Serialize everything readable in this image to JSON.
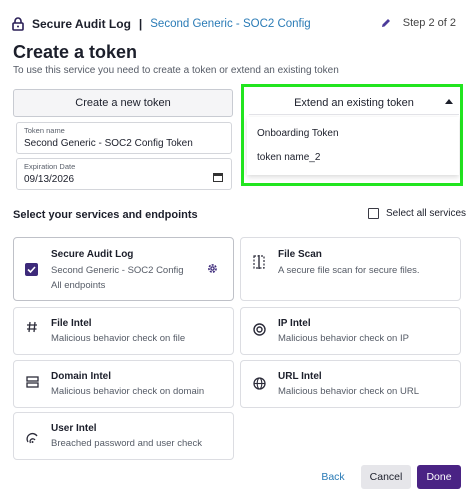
{
  "header": {
    "app_name": "Secure Audit Log",
    "separator": "|",
    "config_name": "Second Generic - SOC2 Config",
    "step": "Step 2 of 2"
  },
  "page": {
    "title": "Create a token",
    "subtitle": "To use this service you need to create a token or extend an existing token"
  },
  "token_form": {
    "create_label": "Create a new token",
    "name_label": "Token name",
    "name_value": "Second Generic - SOC2 Config Token",
    "date_label": "Expiration Date",
    "date_value": "09/13/2026"
  },
  "extend": {
    "label": "Extend an existing token",
    "options": [
      "Onboarding Token",
      "token name_2"
    ]
  },
  "services": {
    "title": "Select your services and endpoints",
    "select_all": "Select all services",
    "cards": {
      "secure_audit_log": {
        "title": "Secure Audit Log",
        "config": "Second Generic - SOC2 Config",
        "endpoints": "All endpoints"
      },
      "file_scan": {
        "title": "File Scan",
        "desc": "A secure file scan for secure files."
      },
      "file_intel": {
        "title": "File Intel",
        "desc": "Malicious behavior check on file"
      },
      "ip_intel": {
        "title": "IP Intel",
        "desc": "Malicious behavior check on IP"
      },
      "domain_intel": {
        "title": "Domain Intel",
        "desc": "Malicious behavior check on domain"
      },
      "url_intel": {
        "title": "URL Intel",
        "desc": "Malicious behavior check on URL"
      },
      "user_intel": {
        "title": "User Intel",
        "desc": "Breached password and user check"
      }
    }
  },
  "footer": {
    "back": "Back",
    "cancel": "Cancel",
    "done": "Done"
  },
  "colors": {
    "accent": "#4a2384",
    "link": "#2a7bb6",
    "highlight": "#22e51f"
  },
  "icons": [
    "lock-icon",
    "pencil-icon",
    "calendar-icon",
    "checkbox-checked-icon",
    "gear-icon",
    "file-scan-icon",
    "hash-icon",
    "ip-icon",
    "server-icon",
    "globe-icon",
    "fingerprint-icon",
    "caret-up-icon"
  ]
}
